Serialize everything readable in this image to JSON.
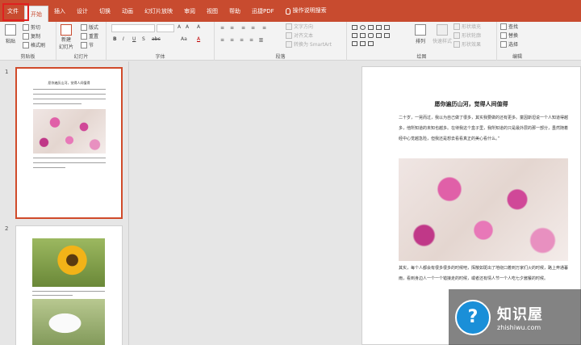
{
  "tabs": {
    "file": "文件",
    "home": "开始",
    "insert": "插入",
    "design": "设计",
    "transitions": "切换",
    "animations": "动画",
    "slideshow": "幻灯片放映",
    "review": "审阅",
    "view": "视图",
    "help": "帮助",
    "pdf": "迅捷PDF",
    "search": "操作说明搜索"
  },
  "ribbon": {
    "clipboard": {
      "paste": "粘贴",
      "cut": "剪切",
      "copy": "复制",
      "format_painter": "格式刷",
      "label": "剪贴板"
    },
    "slides": {
      "new_slide_1": "新建",
      "new_slide_2": "幻灯片",
      "layout": "版式",
      "reset": "重置",
      "section": "节",
      "label": "幻灯片"
    },
    "font": {
      "label": "字体",
      "bold": "B",
      "italic": "I",
      "underline": "U",
      "shadow": "S",
      "strike": "abc",
      "grow": "A",
      "shrink": "A",
      "clear": "A",
      "color": "A",
      "case": "Aa"
    },
    "paragraph": {
      "text_direction": "文字方向",
      "align_text": "对齐文本",
      "smartart": "转换为 SmartArt",
      "label": "段落"
    },
    "drawing": {
      "arrange": "排列",
      "quick_styles": "快速样式",
      "shape_fill": "形状填充",
      "shape_outline": "形状轮廓",
      "shape_effects": "形状效果",
      "label": "绘图"
    },
    "editing": {
      "find": "查找",
      "replace": "替换",
      "select": "选择",
      "label": "编辑"
    }
  },
  "thumbnails": [
    {
      "number": "1",
      "title": "愿你遍历山河，觉得人间值得"
    },
    {
      "number": "2"
    }
  ],
  "slide": {
    "title": "愿你遍历山河，觉得人间值得",
    "para1": "二十岁，一晃而过，我以为自己做了很多，其实我要做的还有更多。童因斯坦说一个人知道得越多，他所知道的未知也越多。在待我这个盒子里，我所知道的只是最外层的那一部分，虽然随着经中心觉越急险，但我还是想去看看真正的美心看什么。”",
    "para2": "其实，每个人都会有很多很多的时候吧，挥散如斑出了地绕口着到万家们火的时候，路上奔通暮雨，看到身边人一个一个错接走的时候，或者还有情人节一个人吃七夕酱餐的时候。"
  },
  "watermark": {
    "main": "知识屋",
    "sub": "zhishiwu.com",
    "badge": "?"
  }
}
